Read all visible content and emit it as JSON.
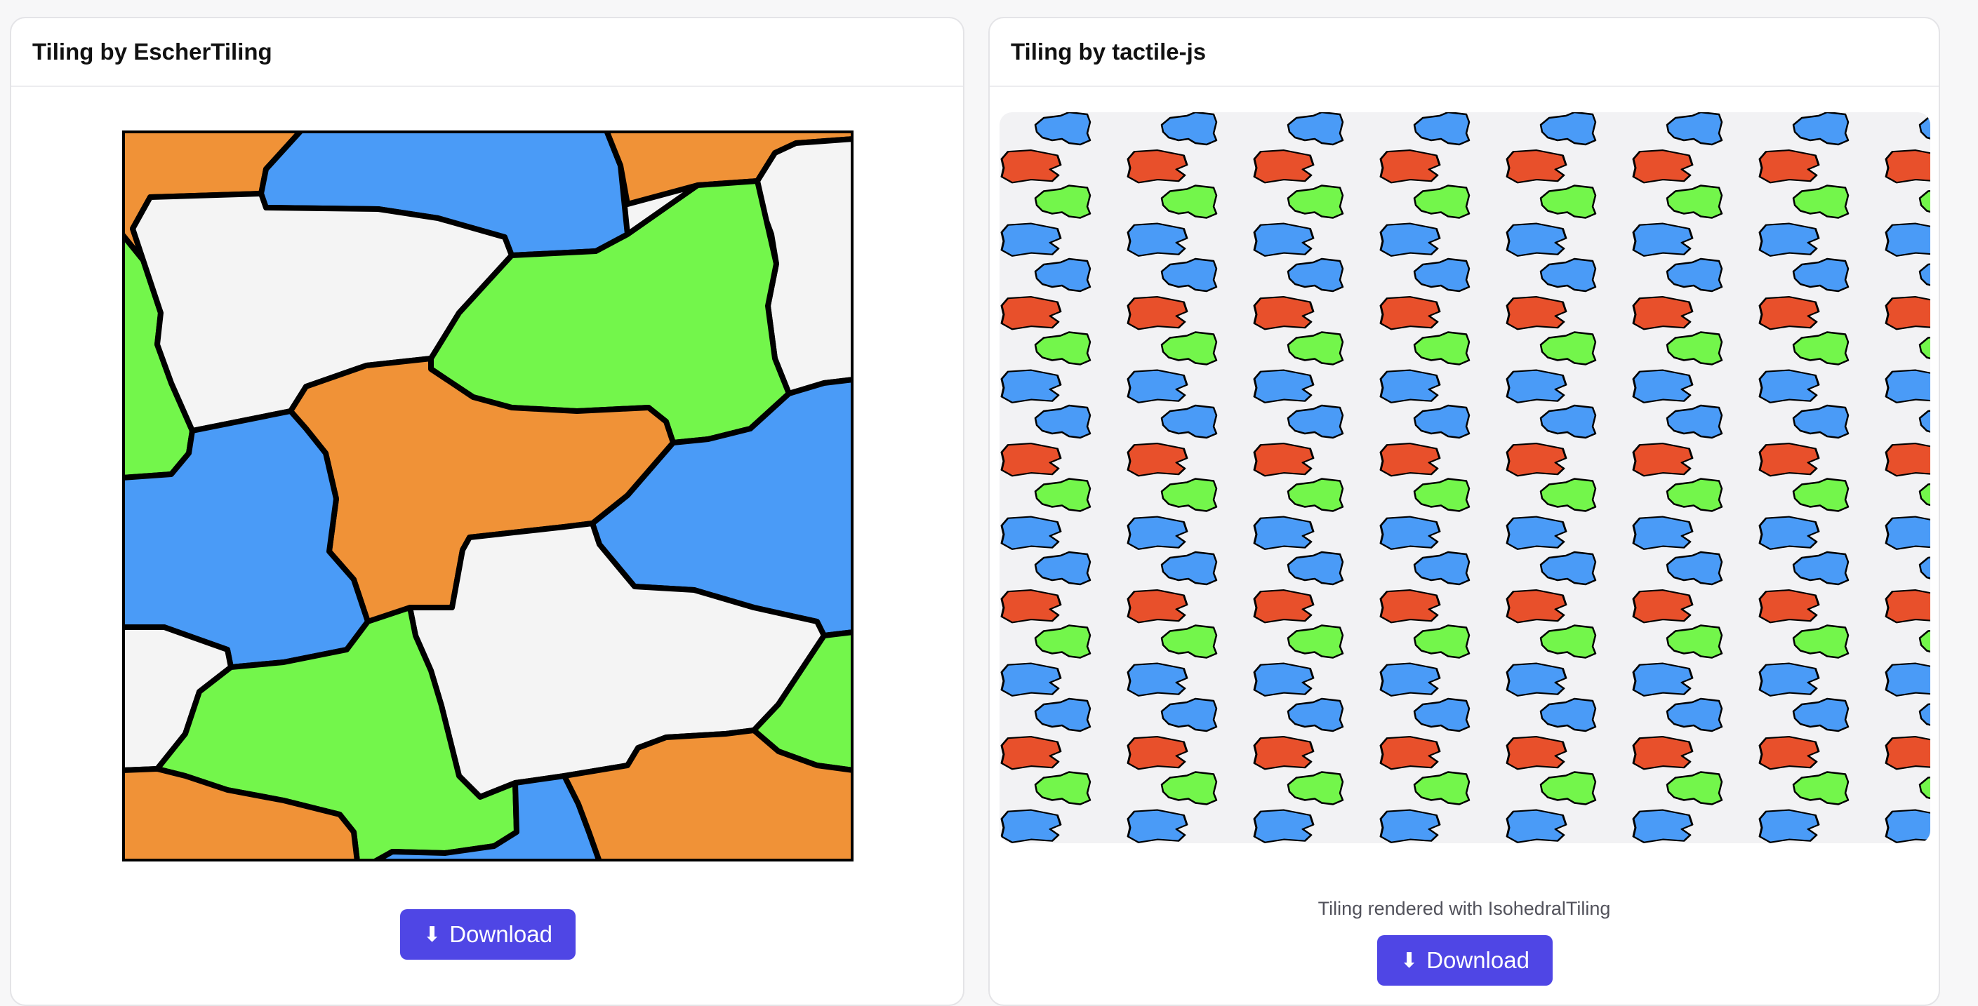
{
  "panels": {
    "left": {
      "title": "Tiling by EscherTiling",
      "download_label": "Download",
      "download_icon": "arrow-down-icon"
    },
    "right": {
      "title": "Tiling by tactile-js",
      "caption": "Tiling rendered with IsohedralTiling",
      "download_label": "Download",
      "download_icon": "arrow-down-icon"
    }
  },
  "colors": {
    "button": "#4f46e5",
    "tile_orange": "#f09237",
    "tile_blue": "#4a9bf7",
    "tile_green": "#73f64b",
    "tile_white": "#f4f4f4",
    "tile_red": "#e8502b",
    "outline": "#000000"
  }
}
